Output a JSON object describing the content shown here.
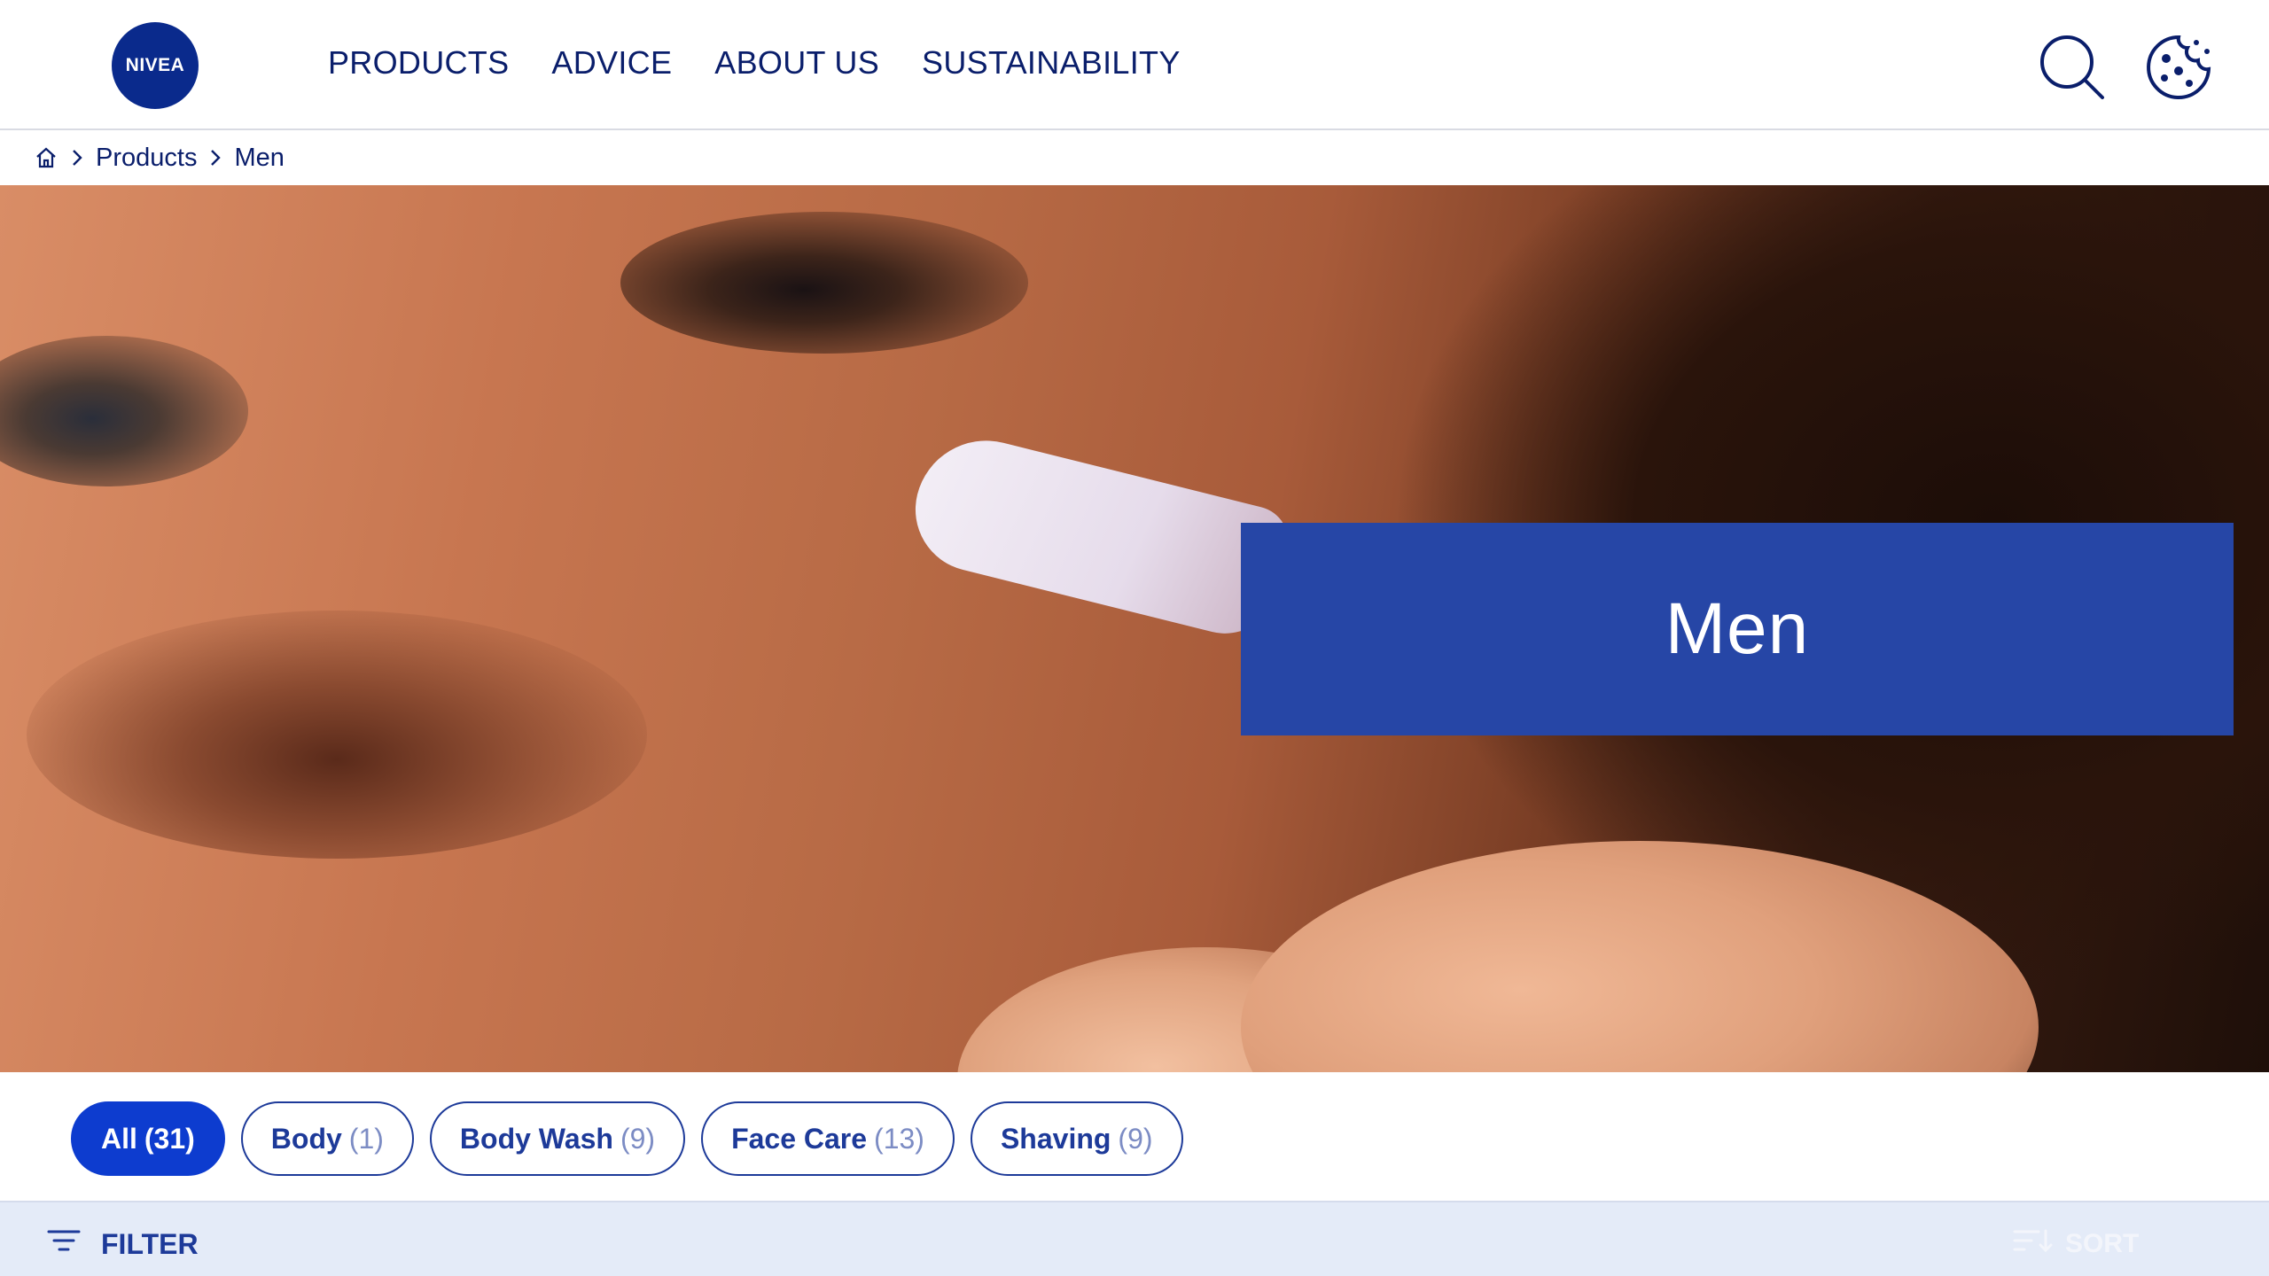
{
  "header": {
    "logo_text": "NIVEA",
    "nav": [
      "PRODUCTS",
      "ADVICE",
      "ABOUT US",
      "SUSTAINABILITY"
    ],
    "icons": [
      "search-icon",
      "cookie-icon"
    ]
  },
  "breadcrumb": {
    "home_icon": "home-icon",
    "items": [
      "Products",
      "Men"
    ]
  },
  "hero": {
    "title": "Men"
  },
  "categories": [
    {
      "label": "All",
      "count": "(31)",
      "active": true
    },
    {
      "label": "Body",
      "count": "(1)",
      "active": false
    },
    {
      "label": "Body Wash",
      "count": "(9)",
      "active": false
    },
    {
      "label": "Face Care",
      "count": "(13)",
      "active": false
    },
    {
      "label": "Shaving",
      "count": "(9)",
      "active": false
    }
  ],
  "toolbar": {
    "filter_label": "FILTER",
    "sort_label": "SORT"
  },
  "colors": {
    "brand_navy": "#0a2a8c",
    "hero_box": "#2646a6",
    "active_pill": "#0d3ccf",
    "filter_bar": "#e4ebf8"
  }
}
